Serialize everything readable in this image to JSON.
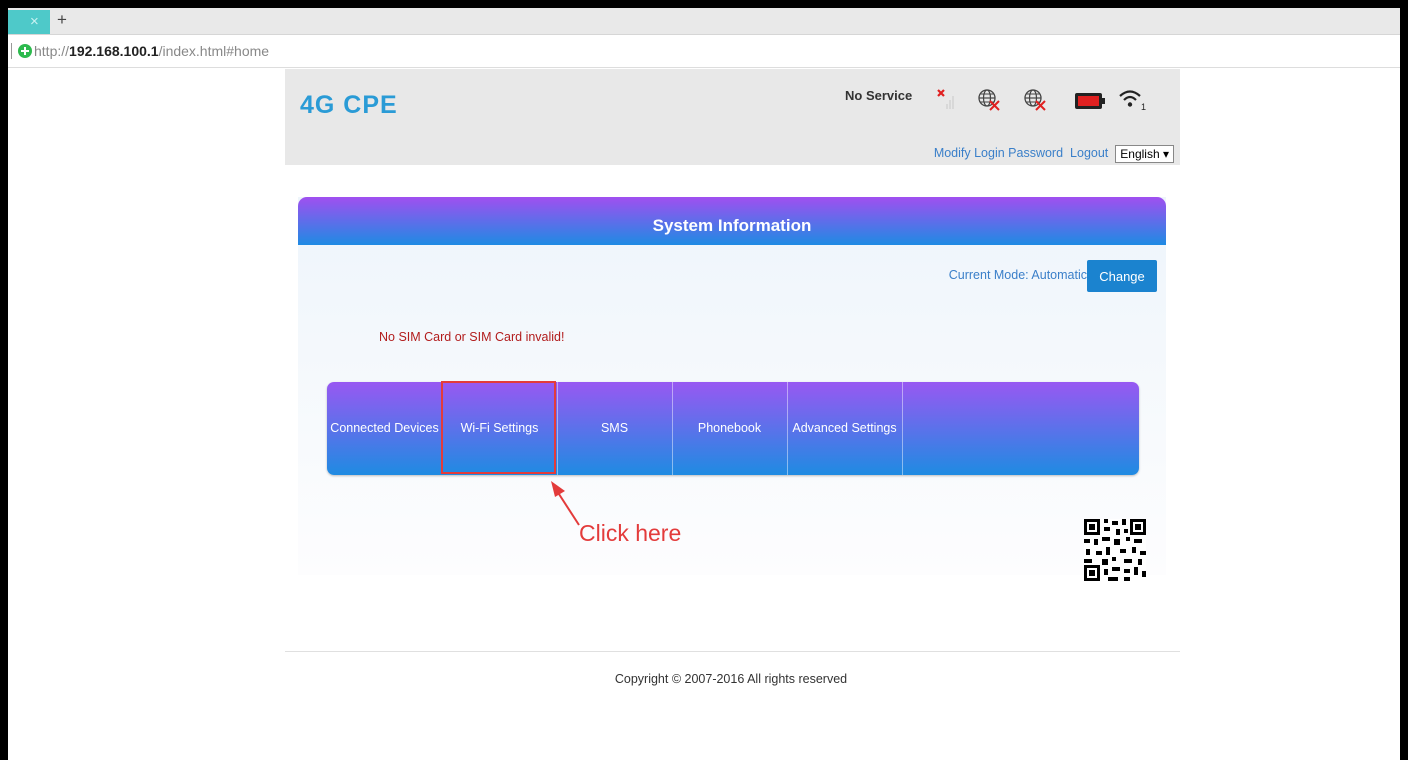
{
  "browser": {
    "tab_close": "×",
    "new_tab": "+",
    "url_prefix": "http://",
    "url_host": "192.168.100.1",
    "url_path": "/index.html#home"
  },
  "header": {
    "logo": "4G CPE",
    "status_text": "No Service",
    "links": {
      "modify_password": "Modify Login Password",
      "logout": "Logout"
    },
    "language": "English ▾",
    "wifi_clients": "1"
  },
  "panel": {
    "title": "System Information",
    "mode_label": "Current Mode: Automatic",
    "change_label": "Change",
    "sim_error": "No SIM Card or SIM Card invalid!"
  },
  "nav": {
    "items": [
      {
        "label": "Connected Devices"
      },
      {
        "label": "Wi-Fi Settings"
      },
      {
        "label": "SMS"
      },
      {
        "label": "Phonebook"
      },
      {
        "label": "Advanced Settings"
      }
    ]
  },
  "annotation": {
    "text": "Click here",
    "color": "#e33b3b"
  },
  "footer": {
    "copyright": "Copyright © 2007-2016 All rights reserved"
  },
  "colors": {
    "accent": "#2a9bd6",
    "gradient_top": "#a04ff0",
    "gradient_bottom": "#1e8be3",
    "error": "#b21d1d"
  }
}
